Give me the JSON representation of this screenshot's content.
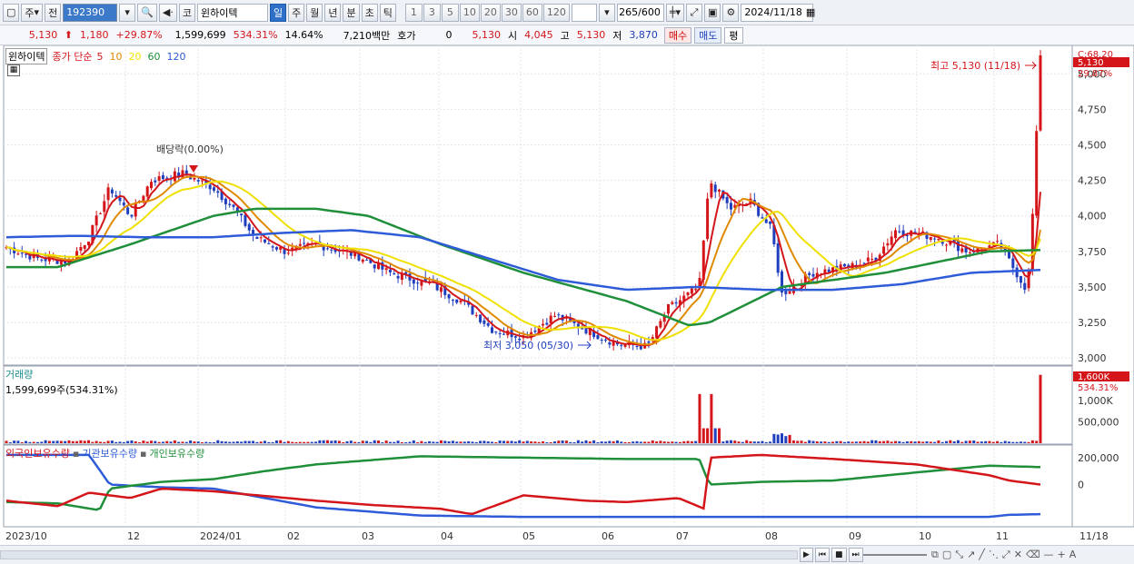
{
  "toolbar": {
    "period_select": "주",
    "prev_label": "전",
    "code": "192390",
    "type_label": "코",
    "stock_name": "윈하이텍",
    "period_tabs": [
      "일",
      "주",
      "월",
      "년",
      "분",
      "초",
      "틱"
    ],
    "active_tab": "일",
    "interval_nums": [
      "1",
      "3",
      "5",
      "10",
      "20",
      "30",
      "60",
      "120"
    ],
    "count_current": "265",
    "count_total": "/600",
    "date": "2024/11/18"
  },
  "quote": {
    "price": "5,130",
    "change": "1,180",
    "change_pct": "+29.87%",
    "volume": "1,599,699",
    "volume_pct": "534.31%",
    "turnover": "14.64%",
    "amount": "7,210백만",
    "hoga_label": "호가",
    "hoga_value": "0",
    "hoga_price": "5,130",
    "open_label": "시",
    "open": "4,045",
    "high_label": "고",
    "high": "5,130",
    "low_label": "저",
    "low": "3,870",
    "buy_label": "매수",
    "sell_label": "매도",
    "avg_label": "평"
  },
  "price_panel": {
    "name_tag": "윈하이텍",
    "ma_label": "종가 단순",
    "ma_periods": [
      "5",
      "10",
      "20",
      "60",
      "120"
    ],
    "ma_colors": [
      "#d4161b",
      "#e08a00",
      "#f0e000",
      "#1f8f3a",
      "#2e5bd8"
    ],
    "y_ticks": [
      "5,000",
      "4,750",
      "4,500",
      "4,250",
      "4,000",
      "3,750",
      "3,500",
      "3,250",
      "3,000"
    ],
    "y_range": [
      2950,
      5200
    ],
    "top_label_c": "C:68.20",
    "current_price_tag": "5,130",
    "current_pct_tag": "29.87%",
    "high_annotation": "최고 5,130 (11/18)",
    "low_annotation": "최저 3,050 (05/30)",
    "dividend_annotation": "배당락(0.00%)"
  },
  "volume_panel": {
    "title": "거래량",
    "current": "1,599,699주(534.31%)",
    "y_ticks": [
      "1,000K",
      "500,000"
    ],
    "tag_value": "1,600K",
    "tag_pct": "534.31%"
  },
  "holding_panel": {
    "series_labels": [
      "외국인보유수량",
      "기관보유수량",
      "개인보유수량"
    ],
    "y_ticks": [
      "200,000",
      "0"
    ]
  },
  "x_axis": {
    "labels": [
      "2023/10",
      "12",
      "2024/01",
      "02",
      "03",
      "04",
      "05",
      "06",
      "07",
      "08",
      "09",
      "10",
      "11"
    ],
    "right_label": "11/18"
  },
  "scroll": {
    "play_icons": [
      "play-icon",
      "prev-icon",
      "stop-icon",
      "next-icon"
    ]
  },
  "chart_data": {
    "type": "line",
    "title": "",
    "moving_averages": [
      {
        "name": "5",
        "color": "#d4161b"
      },
      {
        "name": "10",
        "color": "#e08a00"
      },
      {
        "name": "20",
        "color": "#f0e000"
      },
      {
        "name": "60",
        "color": "#1f8f3a"
      },
      {
        "name": "120",
        "color": "#2e5bd8"
      }
    ],
    "x": [
      "2023/10",
      "12",
      "2024/01",
      "02",
      "03",
      "04",
      "05",
      "06",
      "07",
      "08",
      "09",
      "10",
      "11",
      "11/18"
    ],
    "close_series": [
      3700,
      3850,
      4300,
      4200,
      3750,
      3820,
      3550,
      3150,
      3200,
      3120,
      3400,
      4250,
      3600,
      3780,
      3850,
      3620,
      5130
    ],
    "ma120": [
      3850,
      3860,
      3850,
      3850,
      3880,
      3900,
      3850,
      3700,
      3550,
      3480,
      3500,
      3480,
      3480,
      3520,
      3600,
      3620
    ],
    "ylim": [
      2950,
      5200
    ],
    "high": {
      "value": 5130,
      "date": "11/18"
    },
    "low": {
      "value": 3050,
      "date": "05/30"
    }
  }
}
